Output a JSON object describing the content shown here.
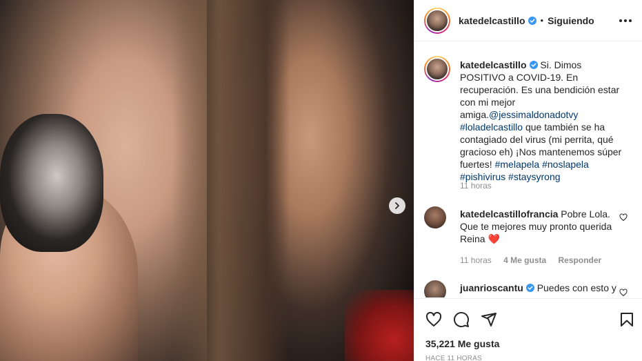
{
  "post": {
    "author": "katedelcastillo",
    "follow_status": "Siguiendo",
    "dot": "•",
    "caption": {
      "author": "katedelcastillo",
      "text_1": "Si. Dimos POSITIVO a COVID-19. En recuperación. Es una bendición estar con mi mejor amiga.",
      "mention": "@jessimaldonadotvy",
      "tag_1": "#loladelcastillo",
      "text_2": "que también se ha contagiado del virus (mi perrita, qué gracioso eh) ¡Nos mantenemos súper fuertes!",
      "tag_2": "#melapela",
      "tag_3": "#noslapela",
      "tag_4": "#pishivirus",
      "tag_5": "#staysyrong",
      "time": "11 horas"
    },
    "comments": [
      {
        "author": "katedelcastillofrancia",
        "text": "Pobre Lola. Que te mejores muy pronto querida Reina",
        "emoji": "❤️",
        "time": "11 horas",
        "likes": "4 Me gusta",
        "reply": "Responder"
      },
      {
        "author": "juanrioscantu",
        "text": "Puedes con esto y"
      }
    ],
    "likes_count": "35,221 Me gusta",
    "posted_ago": "HACE 11 HORAS"
  },
  "colors": {
    "verified": "#3897f0",
    "link": "#00376b",
    "heart": "#ed4956",
    "muted": "#8e8e8e"
  },
  "icons": {
    "more": "more-options-icon",
    "like": "heart-icon",
    "comment": "comment-icon",
    "share": "share-icon",
    "save": "bookmark-icon",
    "next": "chevron-right-icon"
  }
}
